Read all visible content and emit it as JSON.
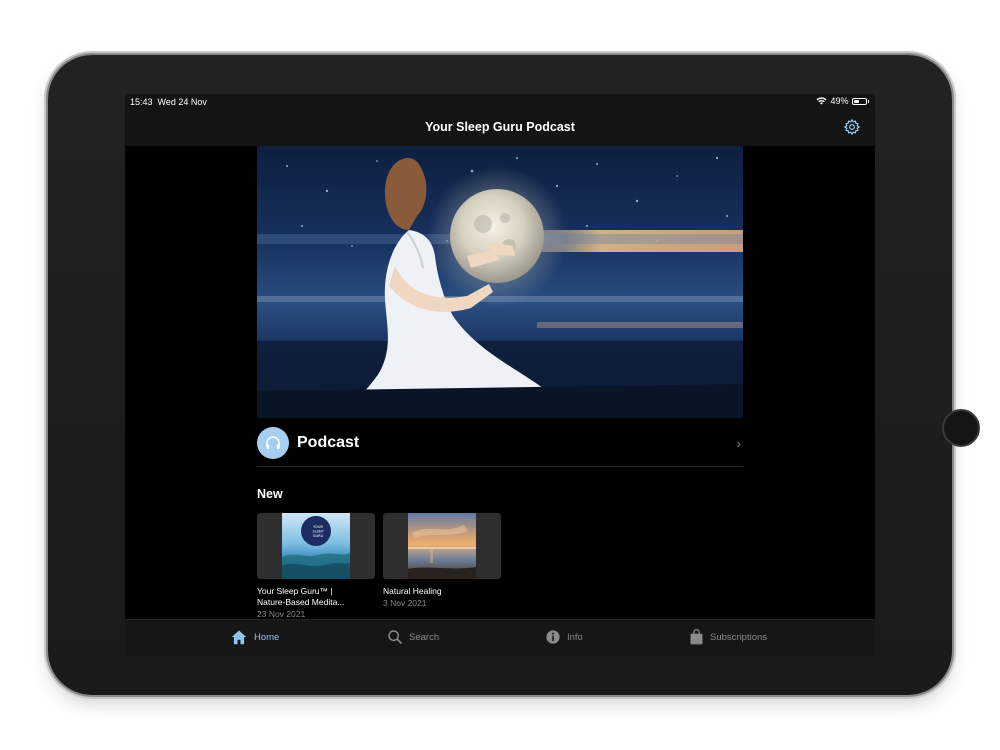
{
  "status_bar": {
    "time": "15:43",
    "date": "Wed 24 Nov",
    "battery": "49%",
    "battery_level": 0.49
  },
  "nav": {
    "title": "Your Sleep Guru Podcast",
    "settings_icon": "gear-icon"
  },
  "podcast_row": {
    "label": "Podcast",
    "icon": "headphones-icon"
  },
  "new_section": {
    "heading": "New",
    "items": [
      {
        "title_line1": "Your Sleep Guru™ |",
        "title_line2": "Nature-Based Medita...",
        "date": "23 Nov 2021"
      },
      {
        "title_line1": "Natural Healing",
        "title_line2": "",
        "date": "3 Nov 2021"
      }
    ]
  },
  "tabs": [
    {
      "label": "Home",
      "icon": "home-icon",
      "active": true
    },
    {
      "label": "Search",
      "icon": "search-icon",
      "active": false
    },
    {
      "label": "Info",
      "icon": "info-icon",
      "active": false
    },
    {
      "label": "Subscriptions",
      "icon": "bag-icon",
      "active": false
    }
  ],
  "colors": {
    "accent": "#8ec3f3",
    "background": "#000000",
    "bar": "#141414"
  }
}
